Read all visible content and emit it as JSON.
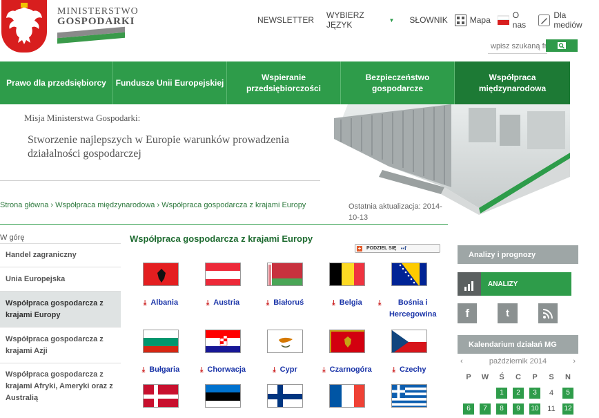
{
  "header": {
    "logo_line1": "Ministerstwo",
    "logo_line2": "Gospodarki",
    "newsletter": "NEWSLETTER",
    "language": "WYBIERZ JĘZYK",
    "glossary": "SŁOWNIK",
    "map": "Mapa",
    "about": "O nas",
    "media": "Dla mediów",
    "search_placeholder": "wpisz szukaną fr"
  },
  "mainnav": [
    {
      "label": "Prawo dla przedsiębiorcy"
    },
    {
      "label": "Fundusze Unii Europejskiej"
    },
    {
      "label": "Wspieranie przedsiębiorczości"
    },
    {
      "label": "Bezpieczeństwo gospodarcze"
    },
    {
      "label": "Współpraca międzynarodowa"
    }
  ],
  "hero": {
    "mission_label": "Misja Ministerstwa Gospodarki:",
    "mission_text": "Stworzenie najlepszych w Europie warunków prowadzenia działalności gospodarczej"
  },
  "breadcrumb": {
    "home": "Strona główna",
    "section": "Współpraca międzynarodowa",
    "page": "Współpraca gospodarcza z krajami Europy"
  },
  "updated": "Ostatnia aktualizacja: 2014-10-13",
  "sidebar": {
    "up": "W górę",
    "items": [
      {
        "label": "Handel zagraniczny"
      },
      {
        "label": "Unia Europejska"
      },
      {
        "label": "Współpraca gospodarcza z krajami Europy"
      },
      {
        "label": "Współpraca gospodarcza z krajami Azji"
      },
      {
        "label": "Współpraca gospodarcza z krajami Afryki, Ameryki oraz z Australią"
      }
    ]
  },
  "content": {
    "title": "Współpraca gospodarcza z krajami Europy",
    "share": "PODZIEL SIĘ",
    "countries": [
      {
        "name": "Albania"
      },
      {
        "name": "Austria"
      },
      {
        "name": "Białoruś"
      },
      {
        "name": "Belgia"
      },
      {
        "name": "Bośnia i Hercegowina"
      },
      {
        "name": "Bułgaria"
      },
      {
        "name": "Chorwacja"
      },
      {
        "name": "Cypr"
      },
      {
        "name": "Czarnogóra"
      },
      {
        "name": "Czechy"
      }
    ]
  },
  "right": {
    "analyses_header": "Analizy i prognozy",
    "analyses_button": "ANALIZY",
    "calendar_header": "Kalendarium działań MG",
    "month": "październik 2014",
    "weekdays": [
      "P",
      "W",
      "Ś",
      "C",
      "P",
      "S",
      "N"
    ],
    "row1": [
      "",
      "",
      "1",
      "2",
      "3",
      "4",
      "5"
    ],
    "row2": [
      "6",
      "7",
      "8",
      "9",
      "10",
      "11",
      "12"
    ]
  }
}
